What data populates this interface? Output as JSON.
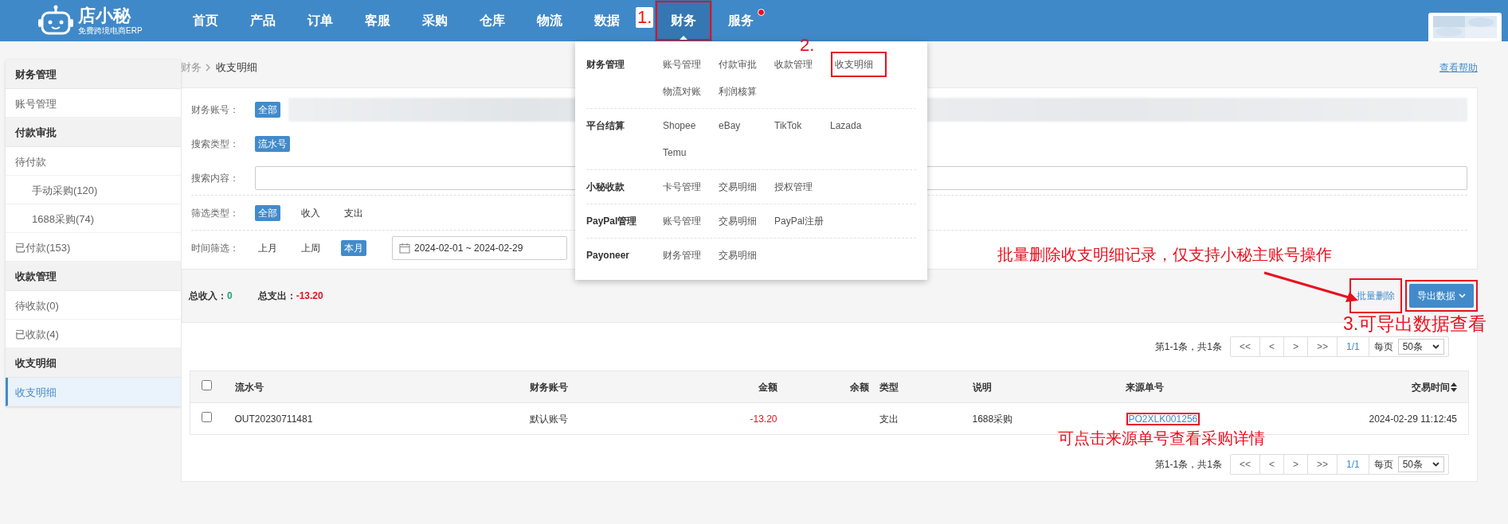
{
  "nav": {
    "logo_text": "店小秘",
    "logo_tagline": "免费跨境电商ERP",
    "items": [
      {
        "label": "首页",
        "selected": false
      },
      {
        "label": "产品",
        "selected": false
      },
      {
        "label": "订单",
        "selected": false
      },
      {
        "label": "客服",
        "selected": false
      },
      {
        "label": "采购",
        "selected": false
      },
      {
        "label": "仓库",
        "selected": false
      },
      {
        "label": "物流",
        "selected": false
      },
      {
        "label": "数据",
        "selected": false
      },
      {
        "label": "财务",
        "selected": true,
        "highlighted": true,
        "step": "1."
      },
      {
        "label": "服务",
        "selected": false,
        "notification": true
      }
    ]
  },
  "dropdown": {
    "groups": [
      {
        "title": "财务管理",
        "links": [
          {
            "label": "账号管理"
          },
          {
            "label": "付款审批"
          },
          {
            "label": "收款管理"
          },
          {
            "label": "收支明细",
            "highlighted": true,
            "step": "2."
          },
          {
            "label": "物流对账"
          },
          {
            "label": "利润核算"
          }
        ]
      },
      {
        "title": "平台结算",
        "links": [
          {
            "label": "Shopee"
          },
          {
            "label": "eBay"
          },
          {
            "label": "TikTok"
          },
          {
            "label": "Lazada"
          },
          {
            "label": "Temu"
          }
        ]
      },
      {
        "title": "小秘收款",
        "links": [
          {
            "label": "卡号管理"
          },
          {
            "label": "交易明细"
          },
          {
            "label": "授权管理"
          }
        ]
      },
      {
        "title": "PayPal管理",
        "links": [
          {
            "label": "账号管理"
          },
          {
            "label": "交易明细"
          },
          {
            "label": "PayPal注册"
          }
        ]
      },
      {
        "title": "Payoneer",
        "links": [
          {
            "label": "财务管理"
          },
          {
            "label": "交易明细"
          }
        ]
      }
    ]
  },
  "sidebar": {
    "sections": [
      {
        "title": "财务管理",
        "items": [
          {
            "label": "账号管理",
            "selected": false
          }
        ]
      },
      {
        "title": "付款审批",
        "items": [
          {
            "label": "待付款",
            "selected": false,
            "children": [
              {
                "label": "手动采购(120)",
                "selected": false
              },
              {
                "label": "1688采购(74)",
                "selected": false
              }
            ]
          },
          {
            "label": "已付款(153)",
            "selected": false
          }
        ]
      },
      {
        "title": "收款管理",
        "items": [
          {
            "label": "待收款(0)",
            "selected": false
          },
          {
            "label": "已收款(4)",
            "selected": false
          }
        ]
      },
      {
        "title": "收支明细",
        "items": [
          {
            "label": "收支明细",
            "selected": true
          }
        ]
      }
    ]
  },
  "breadcrumb": [
    "财务",
    "收支明细"
  ],
  "help_link": "查看帮助",
  "filters": [
    [
      {
        "label": "财务账号：",
        "kind": "tags",
        "options": [
          {
            "label": "全部",
            "selected": true
          }
        ],
        "redacted": true
      },
      {
        "label": "搜索类型：",
        "kind": "tags",
        "options": [
          {
            "label": "流水号",
            "selected": true
          }
        ]
      },
      {
        "label": "搜索内容：",
        "kind": "input"
      }
    ],
    [
      {
        "label": "筛选类型：",
        "kind": "tags",
        "options": [
          {
            "label": "全部",
            "selected": true
          },
          {
            "label": "收入",
            "selected": false
          },
          {
            "label": "支出",
            "selected": false
          }
        ]
      }
    ],
    [
      {
        "label": "时间筛选：",
        "kind": "tags",
        "options": [
          {
            "label": "上月",
            "selected": false
          },
          {
            "label": "上周",
            "selected": false
          },
          {
            "label": "本月",
            "selected": true
          }
        ],
        "date_range": "2024-02-01 ~ 2024-02-29"
      }
    ]
  ],
  "totals": [
    {
      "label": "总收入：",
      "value": "0",
      "kind": "income"
    },
    {
      "label": "总支出：",
      "value": "-13.20",
      "kind": "expense"
    }
  ],
  "actions": [
    {
      "label": "批量删除",
      "kind": "link",
      "highlighted": true
    },
    {
      "label": "导出数据",
      "kind": "dropdown",
      "highlighted": true
    }
  ],
  "pagination_top": {
    "summary": "第1-1条，共1条",
    "buttons": [
      "<<",
      "<",
      ">",
      ">>"
    ],
    "page": "1/1",
    "per_page_label": "每页",
    "per_page": "50条"
  },
  "table": {
    "header_checked": false,
    "columns": [
      {
        "label": "流水号"
      },
      {
        "label": "财务账号"
      },
      {
        "label": "金额"
      },
      {
        "label": "余额"
      },
      {
        "label": "类型"
      },
      {
        "label": "说明"
      },
      {
        "label": "来源单号"
      },
      {
        "label": "交易时间",
        "sortable": true
      }
    ],
    "rows": [
      {
        "checked": false,
        "source_highlighted": true,
        "cells": [
          "OUT20230711481",
          "默认账号",
          "-13.20",
          null,
          "支出",
          "1688采购",
          "PO2XLK001256",
          "2024-02-29 11:12:45"
        ]
      }
    ]
  },
  "pagination_bottom": {
    "summary": "第1-1条，共1条",
    "buttons": [
      "<<",
      "<",
      ">",
      ">>"
    ],
    "page": "1/1",
    "per_page_label": "每页",
    "per_page": "50条"
  },
  "annotations": [
    {
      "text": "批量删除收支明细记录，仅支持小秘主账号操作"
    },
    {
      "text": "3.可导出数据查看"
    },
    {
      "text": "可点击来源单号查看采购详情"
    }
  ]
}
